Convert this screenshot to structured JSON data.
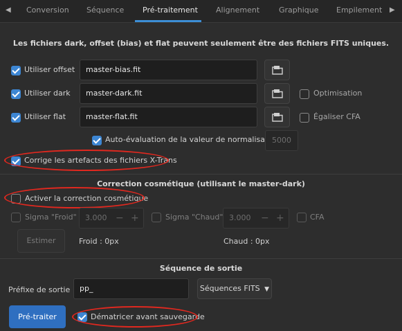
{
  "tabs": {
    "conversion": "Conversion",
    "sequence": "Séquence",
    "preprocessing": "Pré-traitement",
    "alignment": "Alignement",
    "graphics": "Graphique",
    "stacking": "Empilement"
  },
  "masters_notice": "Les fichiers dark, offset (bias) et flat peuvent seulement être des fichiers FITS uniques.",
  "offset": {
    "label": "Utiliser offset",
    "value": "master-bias.fit",
    "checked": true
  },
  "dark": {
    "label": "Utiliser dark",
    "value": "master-dark.fit",
    "checked": true,
    "optimization_label": "Optimisation"
  },
  "flat": {
    "label": "Utiliser flat",
    "value": "master-flat.fit",
    "checked": true,
    "equalize_cfa_label": "Égaliser CFA"
  },
  "auto_eval": {
    "label": "Auto-évaluation de la valeur de normalisation",
    "value": "5000"
  },
  "xtrans": {
    "label": "Corrige les artefacts des fichiers X-Trans"
  },
  "cosmetic": {
    "section_title": "Correction cosmétique (utilisant le master-dark)",
    "enable_label": "Activer la correction cosmétique",
    "sigma_cold_label": "Sigma \"Froid\" :",
    "sigma_cold_value": "3.000",
    "sigma_hot_label": "Sigma \"Chaud\" :",
    "sigma_hot_value": "3.000",
    "cfa_label": "CFA",
    "estimate_button": "Estimer",
    "cold_count": "Froid : 0px",
    "hot_count": "Chaud : 0px"
  },
  "output": {
    "section_title": "Séquence de sortie",
    "prefix_label": "Préfixe de sortie :",
    "prefix_value": "pp_",
    "sequence_type": "Séquences FITS",
    "run_button": "Pré-traiter",
    "debayer_label": "Dématricer avant sauvegarde"
  },
  "colors": {
    "accent": "#3d86d3",
    "annotation": "#e0281f",
    "background": "#2d2d2d"
  }
}
